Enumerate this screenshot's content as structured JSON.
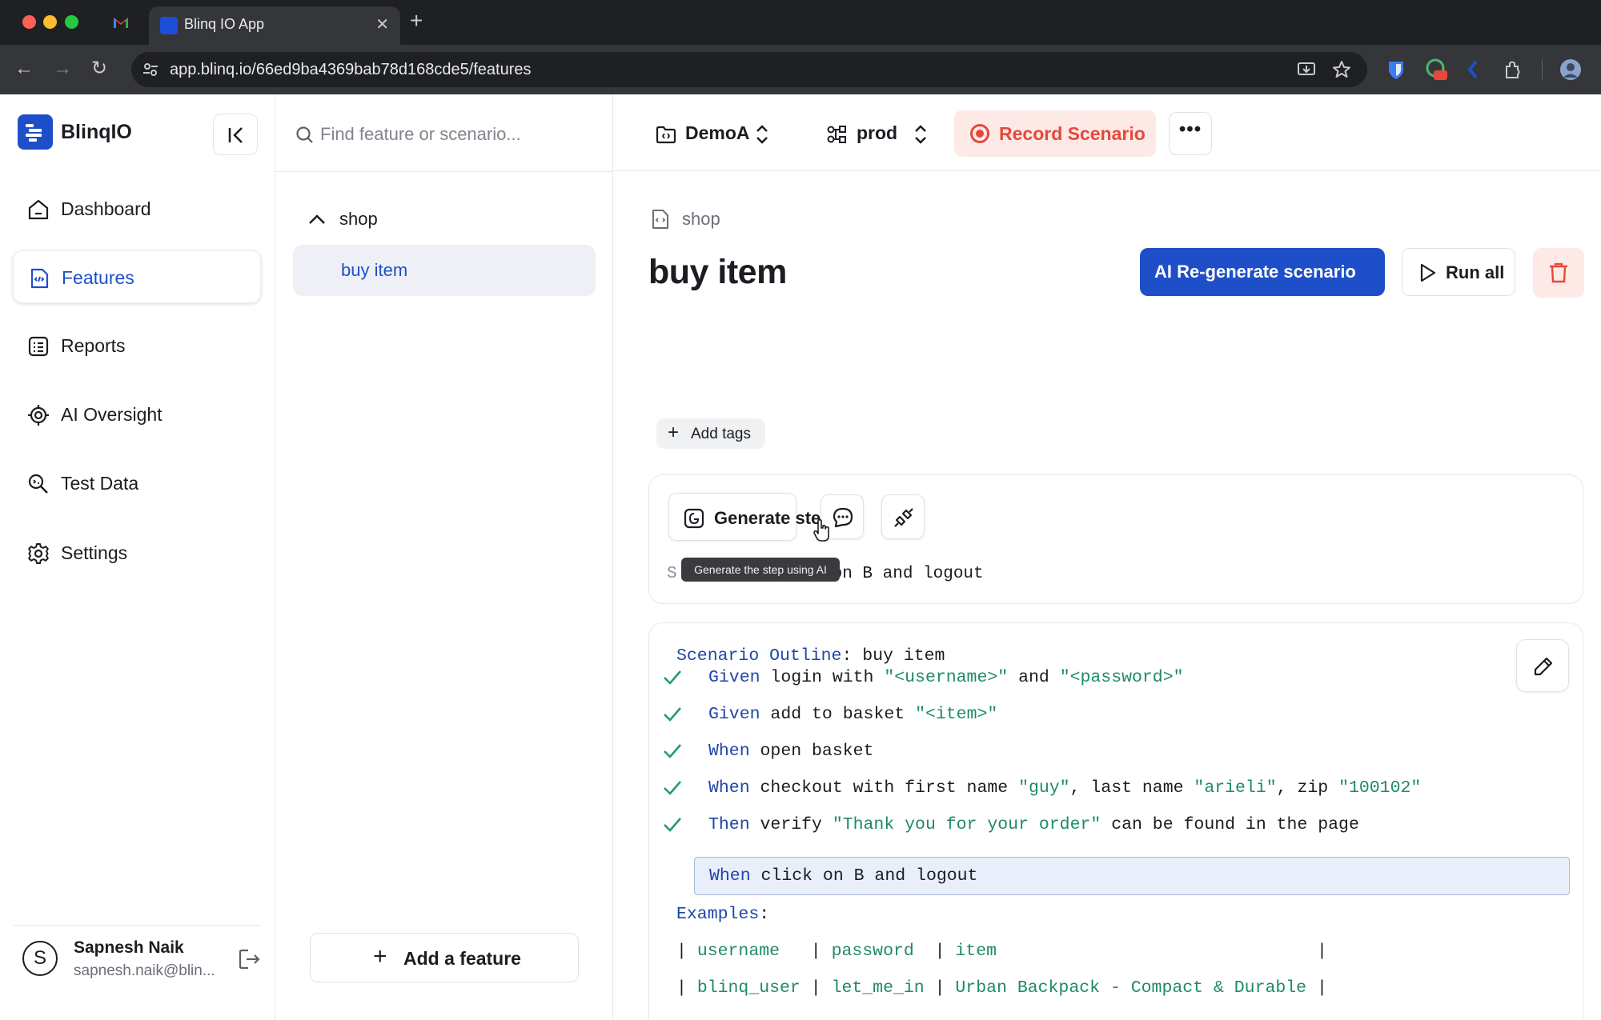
{
  "browser": {
    "tab_title": "Blinq IO App",
    "new_tab_symbol": "+",
    "close_symbol": "✕",
    "url": "app.blinq.io/66ed9ba4369bab78d168cde5/features"
  },
  "sidebar": {
    "brand": "BlinqIO",
    "items": [
      {
        "label": "Dashboard",
        "icon": "home-icon"
      },
      {
        "label": "Features",
        "icon": "features-icon"
      },
      {
        "label": "Reports",
        "icon": "reports-icon"
      },
      {
        "label": "AI Oversight",
        "icon": "ai-oversight-icon"
      },
      {
        "label": "Test Data",
        "icon": "test-data-icon"
      },
      {
        "label": "Settings",
        "icon": "gear-icon"
      }
    ],
    "user": {
      "initial": "S",
      "name": "Sapnesh Naik",
      "email": "sapnesh.naik@blin..."
    }
  },
  "features_panel": {
    "search_placeholder": "Find feature or scenario...",
    "folder": "shop",
    "feature": "buy item",
    "add_feature": "Add a feature",
    "add_symbol": "+"
  },
  "topbar": {
    "project": "DemoA",
    "environment": "prod",
    "record": "Record Scenario",
    "more": "•••"
  },
  "main": {
    "breadcrumb": "shop",
    "title": "buy item",
    "regenerate": "AI  Re-generate scenario",
    "run_all": "Run all",
    "add_tags": "Add tags",
    "add_symbol": "+",
    "generate_step": "Generate step",
    "tooltip": "Generate the step using AI",
    "step_input_prefix": "S",
    "step_input_value": "on B and logout"
  },
  "scenario": {
    "header_kw": "Scenario Outline",
    "header_rest": ": buy item",
    "steps": [
      {
        "kw": "Given",
        "parts": [
          {
            "t": " login with ",
            "s": false
          },
          {
            "t": "\"<username>\"",
            "s": true
          },
          {
            "t": " and ",
            "s": false
          },
          {
            "t": "\"<password>\"",
            "s": true
          }
        ]
      },
      {
        "kw": "Given",
        "parts": [
          {
            "t": " add to basket ",
            "s": false
          },
          {
            "t": "\"<item>\"",
            "s": true
          }
        ]
      },
      {
        "kw": "When",
        "parts": [
          {
            "t": " open basket",
            "s": false
          }
        ]
      },
      {
        "kw": "When",
        "parts": [
          {
            "t": " checkout with first name ",
            "s": false
          },
          {
            "t": "\"guy\"",
            "s": true
          },
          {
            "t": ", last name ",
            "s": false
          },
          {
            "t": "\"arieli\"",
            "s": true
          },
          {
            "t": ", zip ",
            "s": false
          },
          {
            "t": "\"100102\"",
            "s": true
          }
        ]
      },
      {
        "kw": "Then",
        "parts": [
          {
            "t": " verify ",
            "s": false
          },
          {
            "t": "\"Thank you for your order\"",
            "s": true
          },
          {
            "t": " can be found in the page",
            "s": false
          }
        ]
      }
    ],
    "current_step_kw": "When",
    "current_step_rest": " click on B and logout",
    "examples_kw": "Examples",
    "examples_colon": ":",
    "table": {
      "header": [
        "username",
        "password",
        "item"
      ],
      "rows": [
        [
          "blinq_user",
          "let_me_in",
          "Urban Backpack - Compact & Durable"
        ]
      ]
    }
  },
  "colors": {
    "accent": "#1e4fc9",
    "danger": "#e5483a",
    "success": "#1f9d6f",
    "keyword": "#1f45a8",
    "string": "#1f8a6a"
  }
}
